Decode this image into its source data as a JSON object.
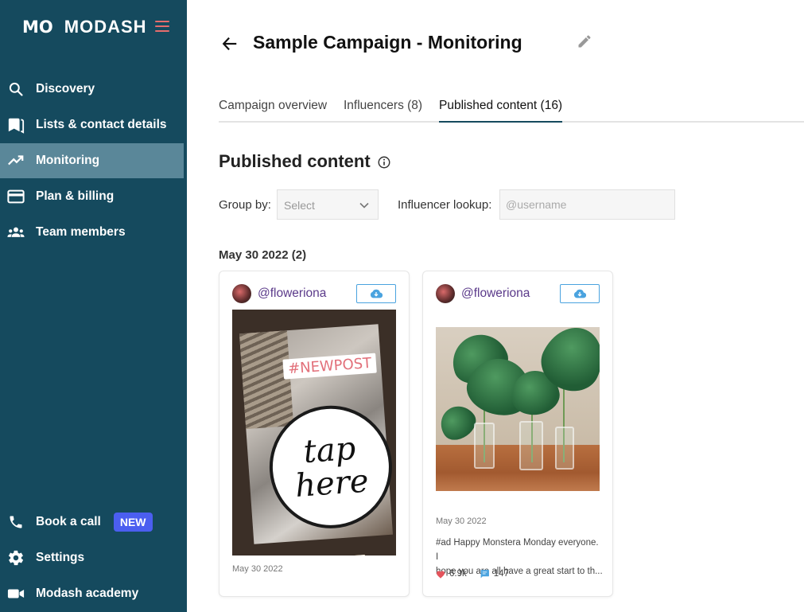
{
  "app": {
    "logo_mark": "MO",
    "logo_text": "MODASH"
  },
  "sidebar": {
    "items": [
      {
        "label": "Discovery",
        "icon": "search-icon"
      },
      {
        "label": "Lists & contact details",
        "icon": "bookmark-icon"
      },
      {
        "label": "Monitoring",
        "icon": "trending-up-icon",
        "active": true
      },
      {
        "label": "Plan & billing",
        "icon": "credit-card-icon"
      },
      {
        "label": "Team members",
        "icon": "people-icon"
      }
    ],
    "bottom_items": [
      {
        "label": "Book a call",
        "icon": "phone-icon",
        "badge": "NEW"
      },
      {
        "label": "Settings",
        "icon": "gear-icon"
      },
      {
        "label": "Modash academy",
        "icon": "video-camera-icon"
      }
    ],
    "colors": {
      "background": "#154a5e",
      "active": "#5a8799",
      "badge": "#4b5ef0",
      "hamburger": "#e56d6d"
    }
  },
  "header": {
    "title": "Sample Campaign - Monitoring"
  },
  "tabs": [
    {
      "label": "Campaign overview"
    },
    {
      "label": "Influencers (8)"
    },
    {
      "label": "Published content (16)",
      "active": true
    }
  ],
  "content": {
    "title": "Published content",
    "group_by_label": "Group by:",
    "group_by_value": "Select",
    "lookup_label": "Influencer lookup:",
    "lookup_placeholder": "@username",
    "date_group": "May 30 2022 (2)"
  },
  "cards": [
    {
      "handle": "@floweriona",
      "type": "story",
      "story_tag": "#NEWPOST",
      "story_text_1": "tap",
      "story_text_2": "here",
      "date": "May 30 2022"
    },
    {
      "handle": "@floweriona",
      "type": "post",
      "date": "May 30 2022",
      "caption_line1": "#ad Happy Monstera Monday everyone. I",
      "caption_line2": "hope you are all have a great start to th...",
      "likes": "6.9k",
      "comments": "147"
    }
  ]
}
